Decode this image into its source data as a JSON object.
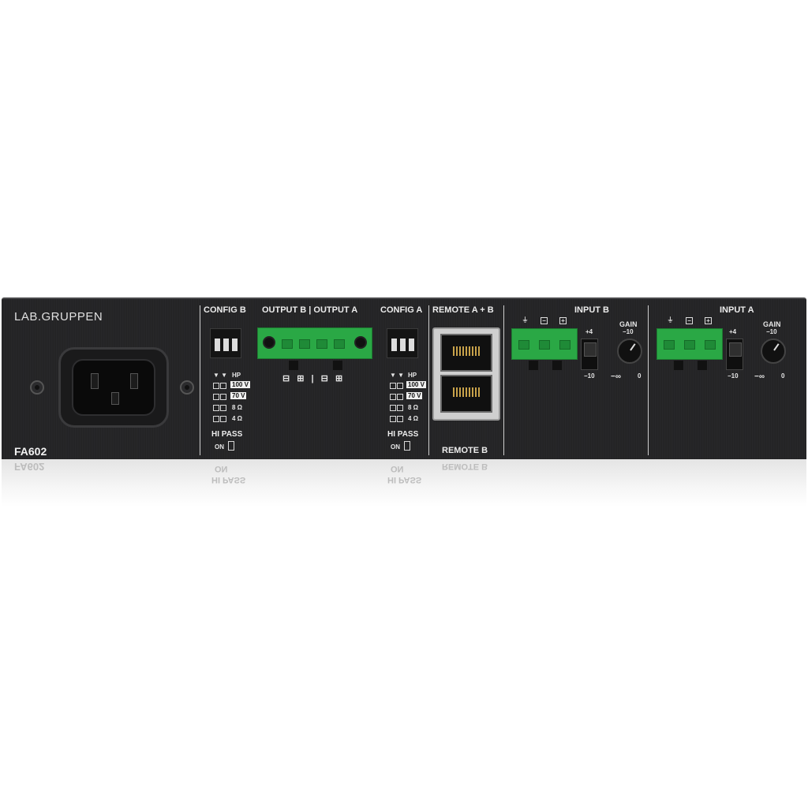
{
  "brand": "LAB.GRUPPEN",
  "model": "FA602",
  "sections": {
    "config_b": "CONFIG B",
    "outputs": "OUTPUT B | OUTPUT A",
    "config_a": "CONFIG A",
    "remote_top": "REMOTE A + B",
    "remote_bottom": "REMOTE B",
    "input_b": "INPUT B",
    "input_a": "INPUT A"
  },
  "config_labels": {
    "hp": "HP",
    "v100": "100 V",
    "v70": "70 V",
    "ohm8": "8 Ω",
    "ohm4": "4 Ω",
    "hipass": "HI PASS",
    "on": "ON",
    "arrows": "▼ ▼"
  },
  "output_polarity": "⊟ ⊞ | ⊟ ⊞",
  "input_labels": {
    "gain": "GAIN",
    "plus4": "+4",
    "minus10": "−10",
    "gain_top": "−10",
    "gain_min": "−∞",
    "gain_max": "0",
    "ground": "⏚",
    "minus": "−",
    "plus": "+"
  },
  "colors": {
    "terminal_green": "#2aa845",
    "panel": "#232325"
  }
}
